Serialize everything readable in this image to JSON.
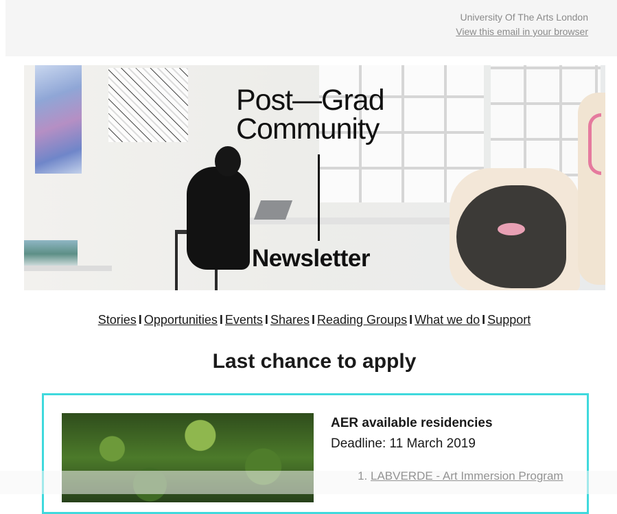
{
  "header": {
    "org_name": "University Of The Arts London",
    "view_in_browser": "View this email in your browser"
  },
  "hero": {
    "title_line1": "Post—Grad",
    "title_line2": "Community",
    "subtitle": "Newsletter"
  },
  "nav": {
    "separator": "I",
    "items": [
      {
        "label": "Stories"
      },
      {
        "label": "Opportunities"
      },
      {
        "label": "Events"
      },
      {
        "label": "Shares"
      },
      {
        "label": "Reading Groups"
      },
      {
        "label": "What we do"
      },
      {
        "label": "Support"
      }
    ]
  },
  "section": {
    "title": "Last chance to apply"
  },
  "card": {
    "heading": "AER available residencies",
    "deadline": "Deadline: 11 March 2019",
    "list": [
      {
        "label": "LABVERDE - Art Immersion Program"
      }
    ]
  }
}
